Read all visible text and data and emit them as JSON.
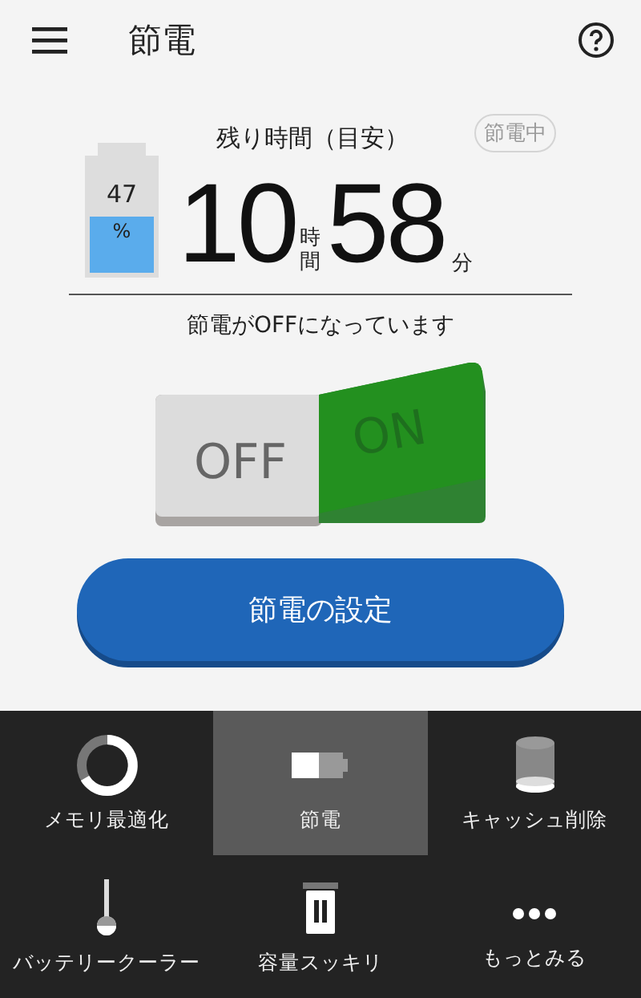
{
  "app_bar": {
    "title": "節電"
  },
  "status": {
    "label": "残り時間（目安）",
    "badge": "節電中",
    "battery_percent": "47",
    "battery_unit": "%",
    "hours": "10",
    "hours_unit": "時間",
    "minutes": "58",
    "minutes_unit": "分",
    "message": "節電がOFFになっています"
  },
  "toggle": {
    "off_label": "OFF",
    "on_label": "ON",
    "on": false
  },
  "settings_button": "節電の設定",
  "nav": [
    {
      "label": "メモリ最適化",
      "selected": false
    },
    {
      "label": "節電",
      "selected": true
    },
    {
      "label": "キャッシュ削除",
      "selected": false
    },
    {
      "label": "バッテリークーラー",
      "selected": false
    },
    {
      "label": "容量スッキリ",
      "selected": false
    },
    {
      "label": "もっとみる",
      "selected": false
    }
  ]
}
